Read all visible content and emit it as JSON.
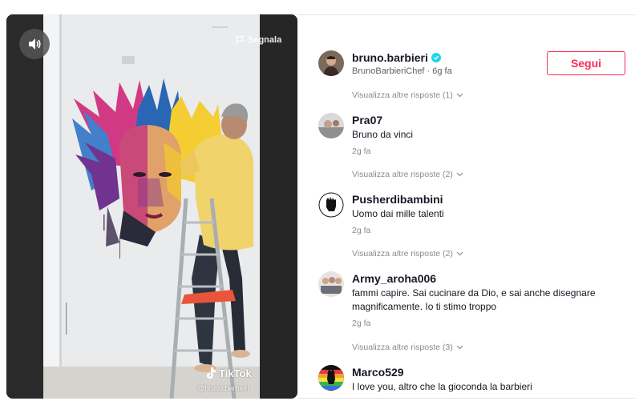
{
  "video": {
    "report_label": "Segnala",
    "brand": "TikTok",
    "watermark_user": "@bruno.barbieri",
    "icons": {
      "sound": "volume-icon",
      "report": "flag-icon",
      "brand": "tiktok-logo-icon"
    }
  },
  "author": {
    "username": "bruno.barbieri",
    "nickname_time": "BrunoBarbieriChef · 6g fa",
    "follow_label": "Segui",
    "colors": {
      "accent": "#fe2c55",
      "verified": "#20d5ec"
    }
  },
  "comments": [
    {
      "more_replies": "Visualizza altre risposte (1)"
    },
    {
      "username": "Pra07",
      "text": "Bruno da vinci",
      "time": "2g fa",
      "more_replies": "Visualizza altre risposte (2)"
    },
    {
      "username": "Pusherdibambini",
      "text": "Uomo dai mille talenti",
      "time": "2g fa",
      "more_replies": "Visualizza altre risposte (2)"
    },
    {
      "username": "Army_aroha006",
      "text": "fammi capire. Sai cucinare da Dio, e sai anche disegnare magnificamente. Io ti stimo troppo",
      "time": "2g fa",
      "more_replies": "Visualizza altre risposte (3)"
    },
    {
      "username": "Marco529",
      "text": "I love you, altro che la gioconda la barbieri"
    }
  ]
}
